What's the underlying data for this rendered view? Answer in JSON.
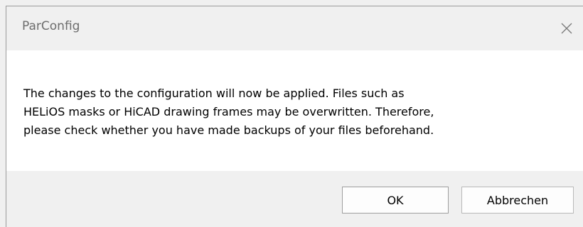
{
  "window": {
    "title": "ParConfig",
    "close_icon": "close-icon"
  },
  "message": {
    "lines": [
      "The changes to the configuration will now be applied. Files such as",
      "HELiOS masks or HiCAD drawing frames may be overwritten. Therefore,",
      "please check whether you have made backups of your files beforehand."
    ]
  },
  "buttons": {
    "ok_label": "OK",
    "cancel_label": "Abbrechen"
  }
}
